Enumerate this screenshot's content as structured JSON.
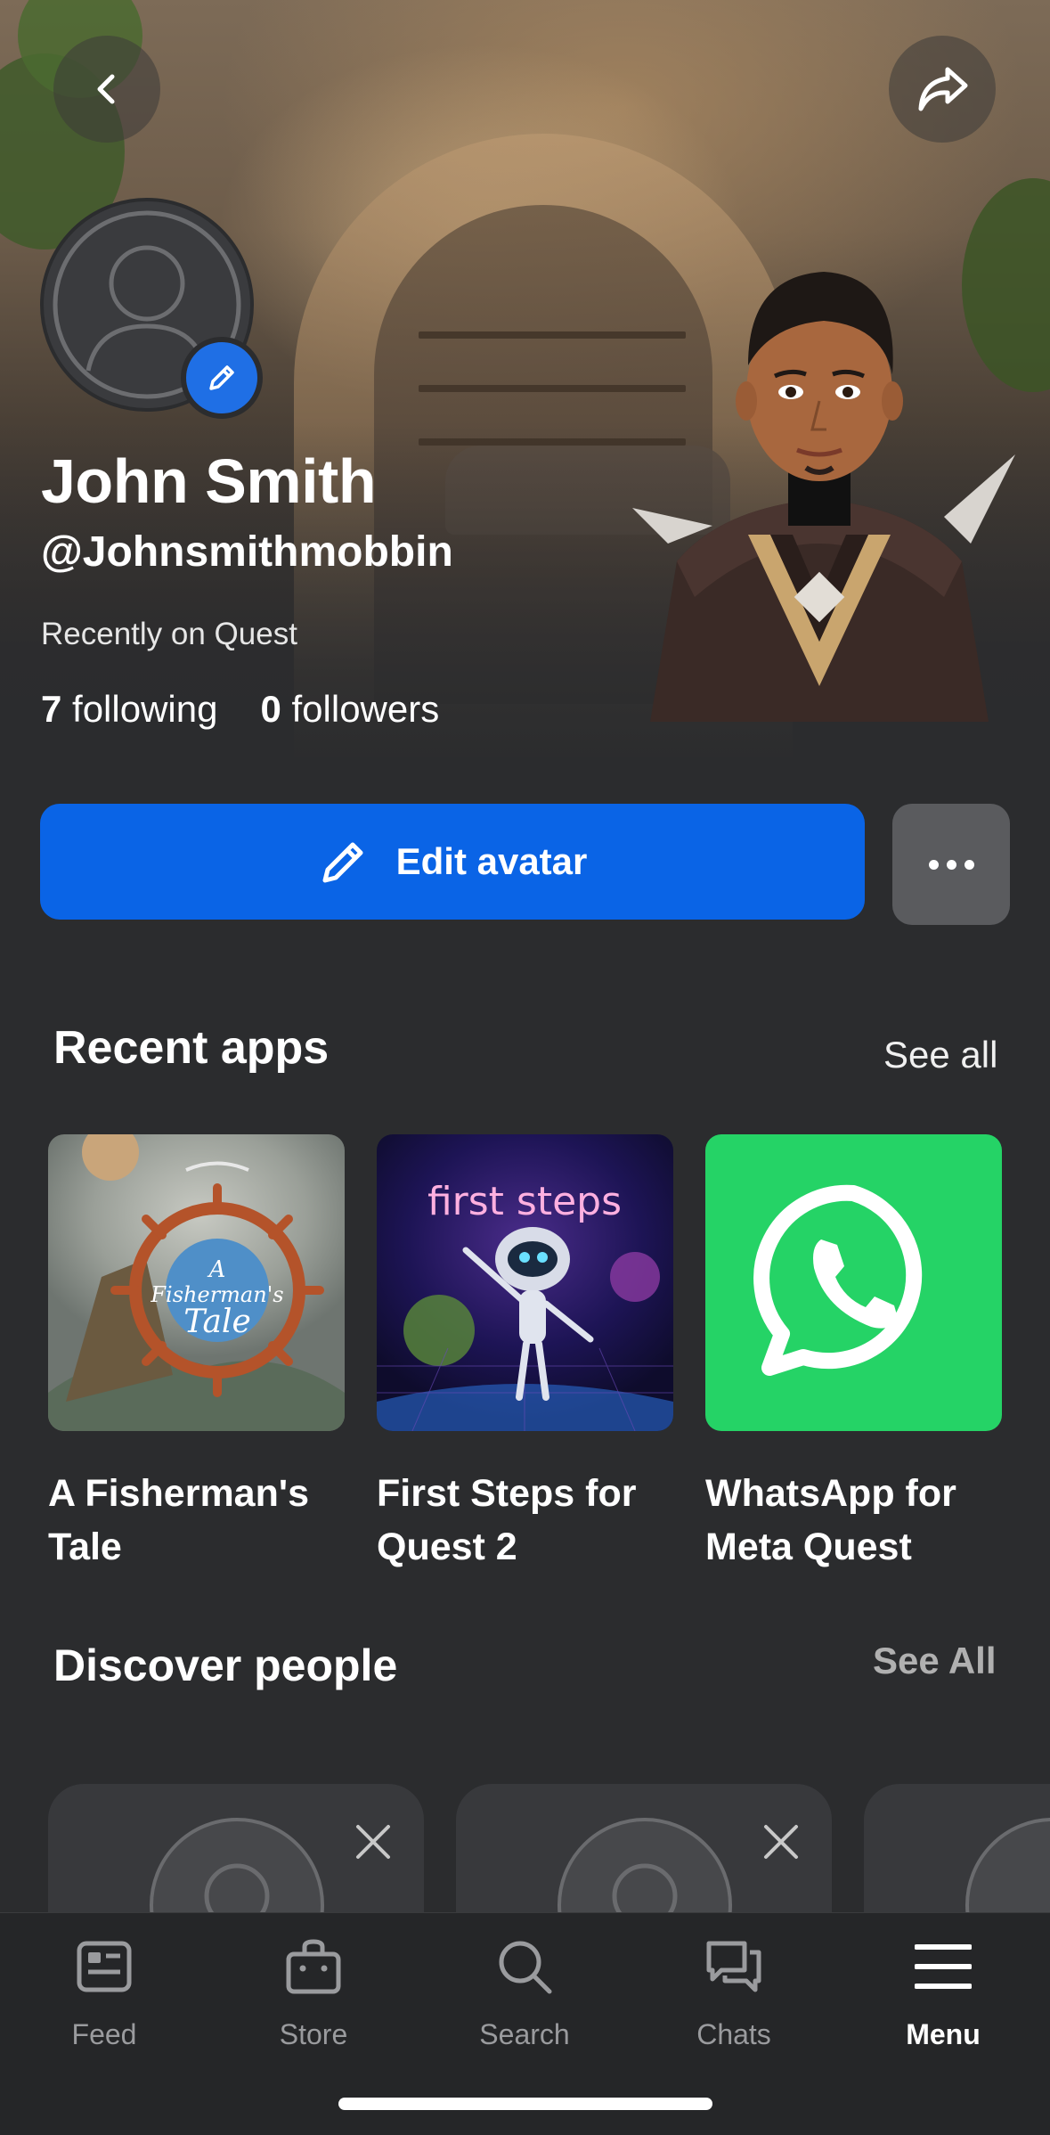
{
  "header": {
    "back_icon": "chevron-left-icon",
    "share_icon": "share-arrow-icon"
  },
  "profile": {
    "name": "John Smith",
    "handle": "@Johnsmithmobbin",
    "status": "Recently on Quest",
    "following_count": "7",
    "following_label": "following",
    "followers_count": "0",
    "followers_label": "followers"
  },
  "actions": {
    "edit_avatar_label": "Edit avatar",
    "more_icon": "ellipsis-icon"
  },
  "recent_apps": {
    "title": "Recent apps",
    "see_all": "See all",
    "apps": [
      {
        "name": "A Fisherman's Tale",
        "thumb_title_line1": "A",
        "thumb_title_line2": "Fisherman's",
        "thumb_title_line3": "Tale",
        "accent": "#c96a2a"
      },
      {
        "name": "First Steps for Quest 2",
        "thumb_title": "first steps",
        "accent": "#5b2a8f"
      },
      {
        "name": "WhatsApp for Meta Quest",
        "accent": "#25d366"
      }
    ]
  },
  "discover": {
    "title": "Discover people",
    "see_all": "See All"
  },
  "nav": {
    "items": [
      {
        "label": "Feed",
        "icon": "feed-icon"
      },
      {
        "label": "Store",
        "icon": "store-bag-icon"
      },
      {
        "label": "Search",
        "icon": "search-icon"
      },
      {
        "label": "Chats",
        "icon": "chat-bubbles-icon"
      },
      {
        "label": "Menu",
        "icon": "hamburger-menu-icon"
      }
    ],
    "active": "Menu"
  },
  "colors": {
    "background": "#2b2c2e",
    "primary_button": "#0a64e6",
    "secondary_button": "#5a5b5e",
    "nav_background": "#252628"
  }
}
